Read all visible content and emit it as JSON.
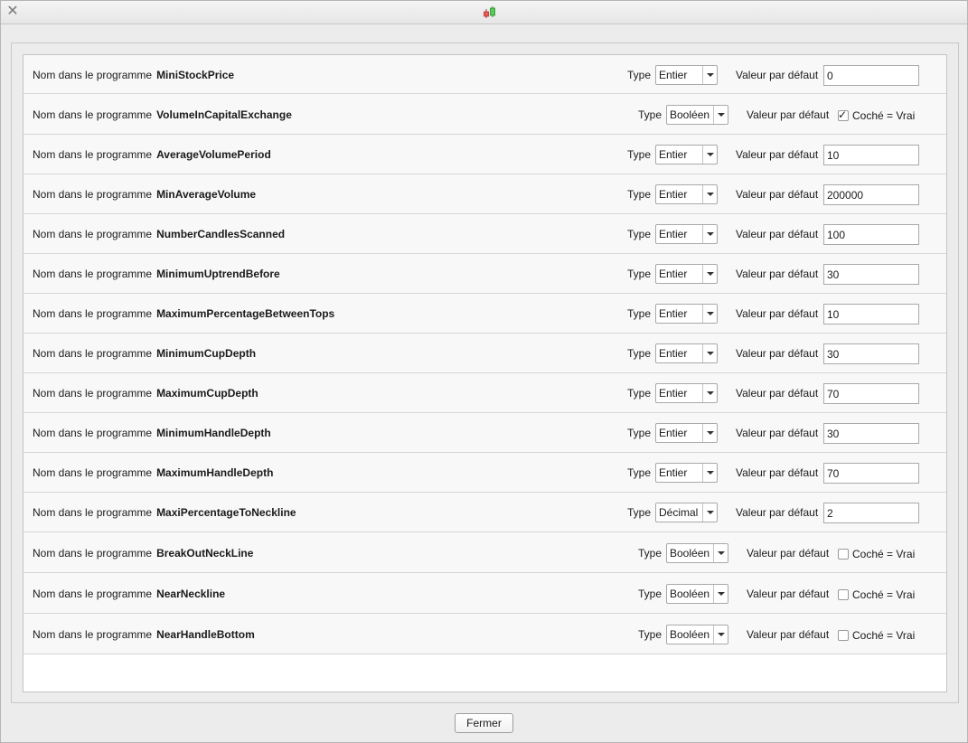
{
  "window": {
    "close_icon": "close-icon",
    "app_icon": "candlestick-chart-icon",
    "title": ""
  },
  "labels": {
    "name_prefix": "Nom dans le programme",
    "type": "Type",
    "default": "Valeur par défaut",
    "checked_true": "Coché = Vrai"
  },
  "variables": [
    {
      "name": "MiniStockPrice",
      "type": "Entier",
      "value": "0"
    },
    {
      "name": "VolumeInCapitalExchange",
      "type": "Booléen",
      "checked": true
    },
    {
      "name": "AverageVolumePeriod",
      "type": "Entier",
      "value": "10"
    },
    {
      "name": "MinAverageVolume",
      "type": "Entier",
      "value": "200000"
    },
    {
      "name": "NumberCandlesScanned",
      "type": "Entier",
      "value": "100"
    },
    {
      "name": "MinimumUptrendBefore",
      "type": "Entier",
      "value": "30"
    },
    {
      "name": "MaximumPercentageBetweenTops",
      "type": "Entier",
      "value": "10"
    },
    {
      "name": "MinimumCupDepth",
      "type": "Entier",
      "value": "30"
    },
    {
      "name": "MaximumCupDepth",
      "type": "Entier",
      "value": "70"
    },
    {
      "name": "MinimumHandleDepth",
      "type": "Entier",
      "value": "30"
    },
    {
      "name": "MaximumHandleDepth",
      "type": "Entier",
      "value": "70"
    },
    {
      "name": "MaxiPercentageToNeckline",
      "type": "Décimal",
      "value": "2"
    },
    {
      "name": "BreakOutNeckLine",
      "type": "Booléen",
      "checked": false
    },
    {
      "name": "NearNeckline",
      "type": "Booléen",
      "checked": false
    },
    {
      "name": "NearHandleBottom",
      "type": "Booléen",
      "checked": false
    }
  ],
  "footer": {
    "close_label": "Fermer"
  }
}
